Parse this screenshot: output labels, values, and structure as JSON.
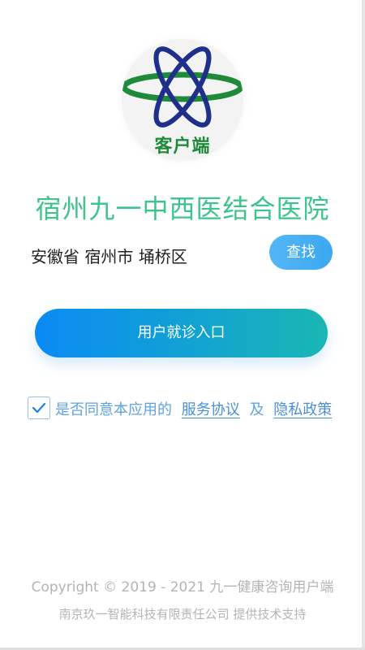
{
  "logo": {
    "text": "客户端",
    "icon": "atom-logo-icon",
    "colors": {
      "ring": "#1f8a3a",
      "orbit": "#1f2f8a",
      "background": "#f3f3f3"
    }
  },
  "hospital": {
    "name": "宿州九一中西医结合医院"
  },
  "location": {
    "text": "安徽省 宿州市 埇桥区",
    "search_label": "查找"
  },
  "entry": {
    "label": "用户就诊入口"
  },
  "agreement": {
    "checked": true,
    "prefix": "是否同意本应用的",
    "service_link": "服务协议",
    "connector": "及",
    "privacy_link": "隐私政策"
  },
  "footer": {
    "copyright": "Copyright © 2019 - 2021 九一健康咨询用户端",
    "support": "南京玖一智能科技有限责任公司 提供技术支持"
  },
  "theme": {
    "primary_green": "#3cc48a",
    "button_blue": "#0a8af5",
    "button_teal": "#19b7b3",
    "link_blue": "#4a8fd6"
  }
}
